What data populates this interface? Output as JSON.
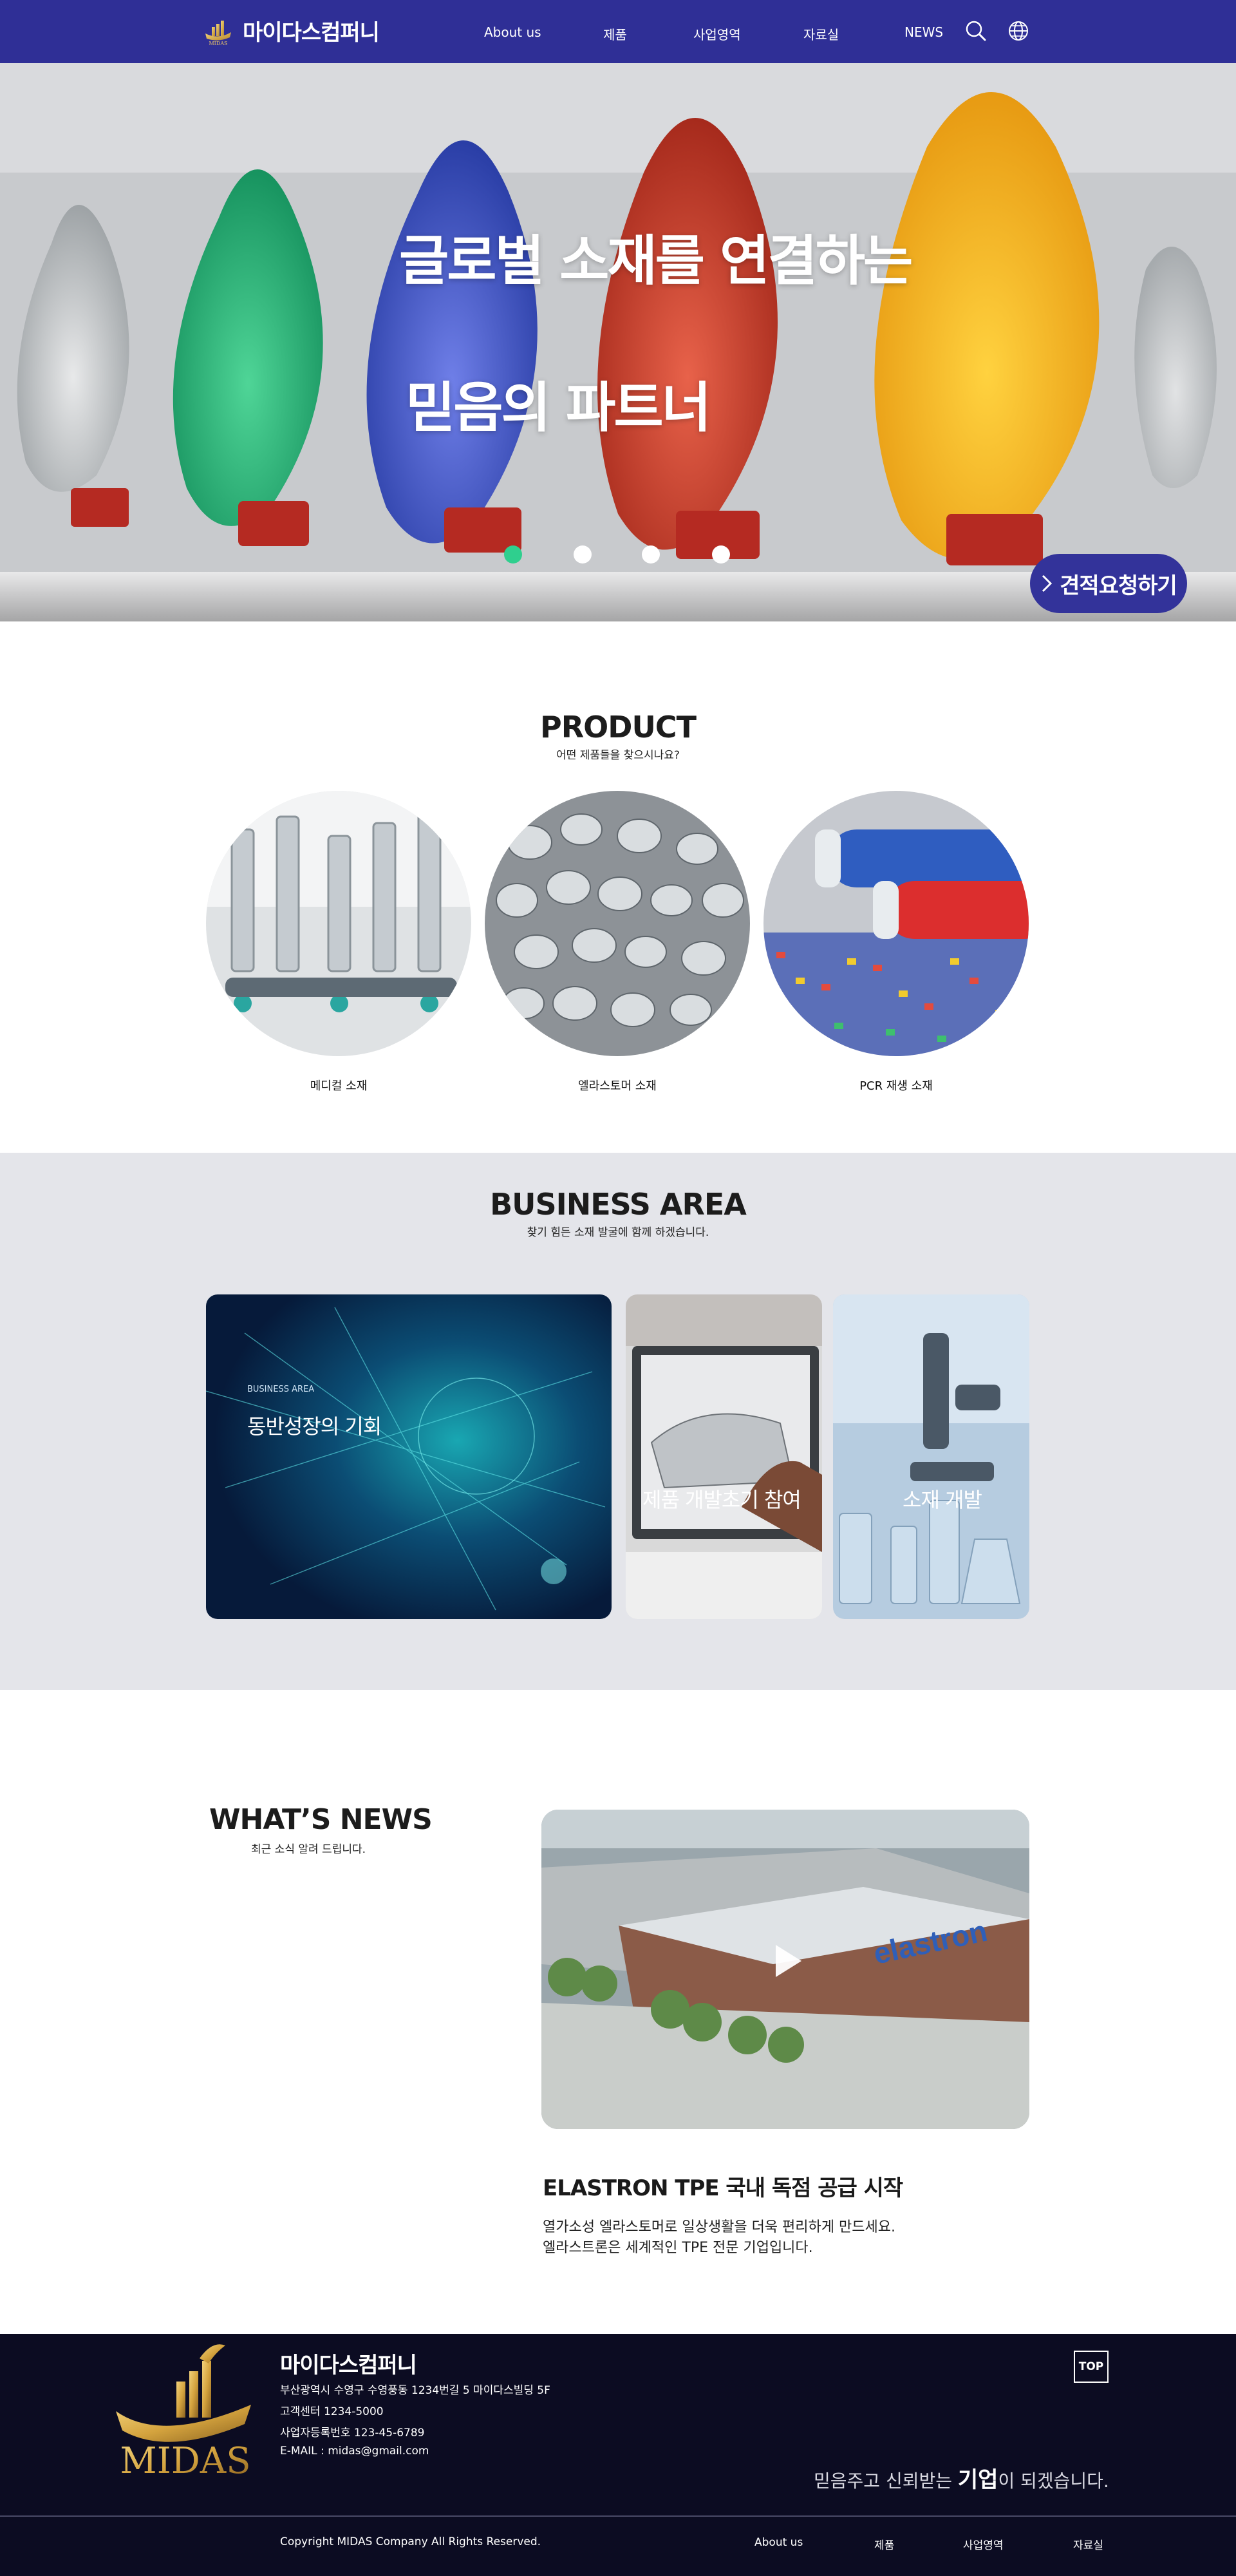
{
  "header": {
    "logo_text": "마이다스컴퍼니",
    "logo_small": "MIDAS",
    "nav": [
      "About us",
      "제품",
      "사업영역",
      "자료실",
      "NEWS"
    ],
    "icons": [
      "search-icon",
      "globe-icon"
    ]
  },
  "hero": {
    "title_line1": "글로벌 소재를 연결하는",
    "title_line2": "믿음의 파트너",
    "slides": 4,
    "active_slide": 1,
    "cta_label": "견적요청하기"
  },
  "product": {
    "title": "PRODUCT",
    "subtitle": "어떤 제품들을 찾으시나요?",
    "items": [
      "메디컬 소재",
      "엘라스토머 소재",
      "PCR 재생 소재"
    ]
  },
  "business": {
    "title": "BUSINESS AREA",
    "subtitle": "찾기 힘든 소재 발굴에 함께 하겠습니다.",
    "card_tag": "BUSINESS AREA",
    "cards": [
      "동반성장의 기회",
      "제품 개발초기 참여",
      "소재 개발"
    ]
  },
  "news": {
    "title": "WHAT’S NEWS",
    "subtitle": "최근 소식 알려 드립니다.",
    "headline": "ELASTRON TPE 국내 독점 공급 시작",
    "body_line1": "열가소성 엘라스토머로 일상생활을 더욱 편리하게 만드세요.",
    "body_line2": "엘라스트론은 세계적인 TPE 전문 기업입니다.",
    "building_sign": "elastron"
  },
  "footer": {
    "logo_text": "MIDAS",
    "company": "마이다스컴퍼니",
    "address": "부산광역시 수영구 수영풍동 1234번길 5 마이다스빌딩 5F",
    "phone": "고객센터 1234-5000",
    "biz_no": "사업자등록번호 123-45-6789",
    "email": "E-MAIL : midas@gmail.com",
    "top_label": "TOP",
    "slogan_pre": "믿음주고 신뢰받는 ",
    "slogan_bold": "기업",
    "slogan_post": "이 되겠습니다.",
    "copyright": "Copyright  MIDAS Company     All Rights Reserved.",
    "links": [
      "About us",
      "제품",
      "사업영역",
      "자료실"
    ]
  },
  "colors": {
    "primary": "#2f2f96",
    "accent_dot": "#2fcf8e",
    "footer_bg": "#0c0c22",
    "business_bg": "#e4e5ea",
    "gold": "#c9a13b"
  }
}
